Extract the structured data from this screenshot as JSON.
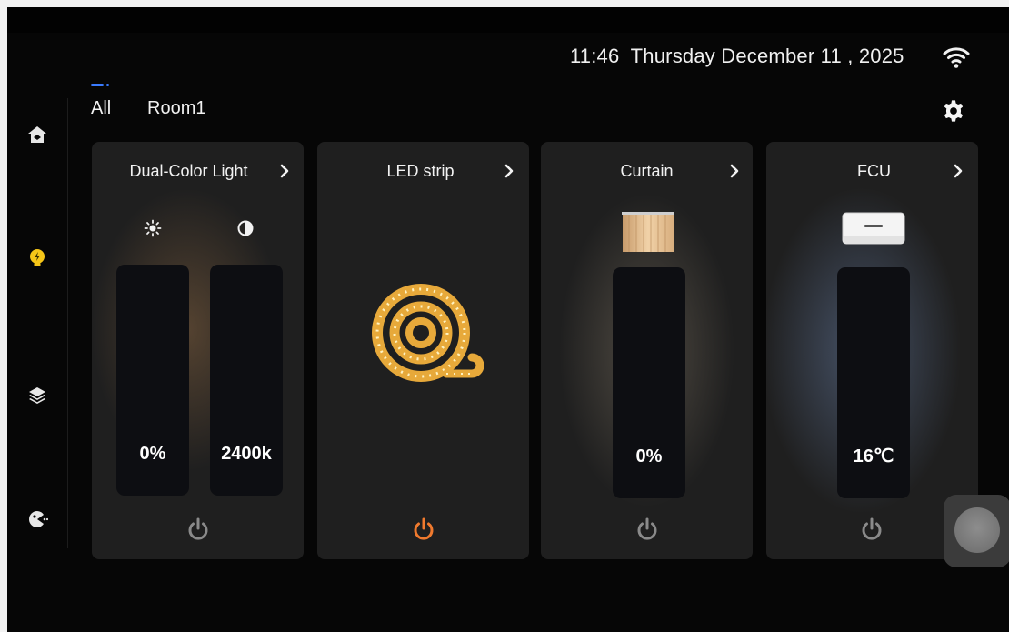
{
  "status": {
    "time": "11:46",
    "date": "Thursday December 11 , 2025",
    "wifi_icon": "wifi-icon"
  },
  "sidebar": {
    "items": [
      {
        "name": "home",
        "icon": "home-icon"
      },
      {
        "name": "lighting",
        "icon": "lightbulb-icon",
        "active": true
      },
      {
        "name": "scenes",
        "icon": "layers-icon"
      },
      {
        "name": "mode",
        "icon": "mode-icon"
      }
    ]
  },
  "tabs": [
    {
      "label": "All",
      "active": true
    },
    {
      "label": "Room1",
      "active": false
    }
  ],
  "settings_icon": "gear-icon",
  "cards": [
    {
      "title": "Dual-Color Light",
      "brightness_icon": "sun-icon",
      "color_temp_icon": "contrast-icon",
      "brightness_value": "0%",
      "color_temp_value": "2400k",
      "power_on": false
    },
    {
      "title": "LED strip",
      "image": "led-strip-icon",
      "power_on": true
    },
    {
      "title": "Curtain",
      "image": "curtain-icon",
      "position_value": "0%",
      "power_on": false
    },
    {
      "title": "FCU",
      "image": "air-conditioner-icon",
      "temperature_value": "16℃",
      "power_on": false
    }
  ],
  "colors": {
    "accent_blue": "#3a7bff",
    "power_active": "#f07a2e",
    "power_inactive": "#8a8a8a",
    "active_nav": "#f5c518"
  }
}
